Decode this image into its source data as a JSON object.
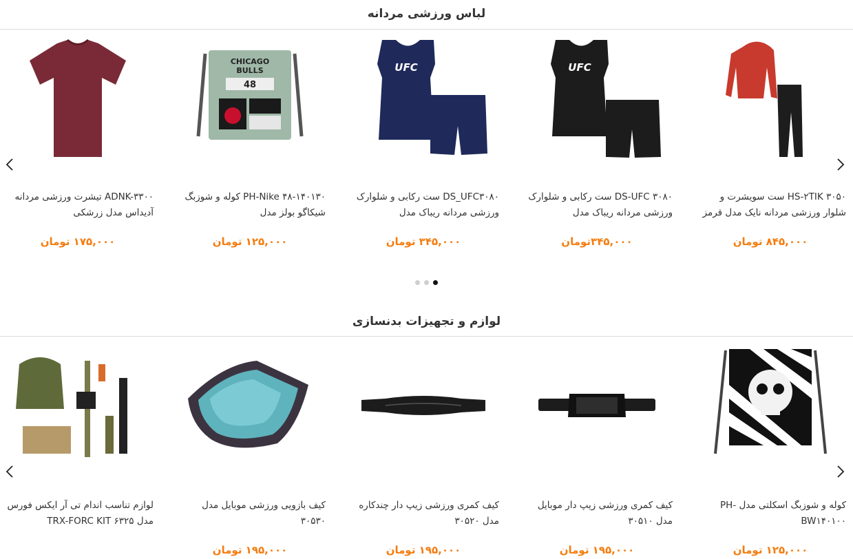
{
  "sections": [
    {
      "title": "لباس ورزشی مردانه",
      "products": [
        {
          "name": "ADNK-۳۳۰۰ تیشرت ورزشی مردانه آدیداس مدل زرشکی",
          "price": "۱۷۵,۰۰۰ تومان"
        },
        {
          "name": "PH-Nike ۴۸-۱۴۰۱۳۰ کوله و شوزبگ شیکاگو بولز مدل",
          "price": "۱۲۵,۰۰۰ تومان"
        },
        {
          "name": "DS_UFC۳۰۸۰ ست رکابی و شلوارک ورزشی مردانه ریباک مدل",
          "price": "۳۴۵,۰۰۰ تومان"
        },
        {
          "name": "DS-UFC ۳۰۸۰ ست رکابی و شلوارک ورزشی مردانه ریباک مدل",
          "price": "۳۴۵,۰۰۰تومان"
        },
        {
          "name": "HS-۲TIK ۳۰۵۰ ست سویشرت و شلوار ورزشی مردانه نایک مدل قرمز",
          "price": "۸۴۵,۰۰۰ تومان"
        }
      ]
    },
    {
      "title": "لوازم و تجهیزات بدنسازی",
      "products": [
        {
          "name": "لوازم تناسب اندام تی آر ایکس فورس مدل TRX-FORC KIT ۶۳۲۵",
          "price": ""
        },
        {
          "name": "کیف بازویی ورزشی موبایل مدل ۳۰۵۳۰",
          "price": "۱۹۵,۰۰۰ تومان"
        },
        {
          "name": "کیف کمری ورزشی زیپ دار چندکاره مدل ۳۰۵۲۰",
          "price": "۱۹۵,۰۰۰ تومان"
        },
        {
          "name": "کیف کمری ورزشی زیپ دار موبایل مدل ۳۰۵۱۰",
          "price": "۱۹۵,۰۰۰ تومان"
        },
        {
          "name": "کوله و شوزبگ اسکلتی مدل -PH BW۱۴۰۱۰۰",
          "price": "۱۲۵,۰۰۰ تومان"
        }
      ]
    }
  ],
  "carousel_dots": {
    "count": 3,
    "active_index": 2
  },
  "icons": [
    "chevron-left-icon",
    "chevron-right-icon"
  ],
  "colors": {
    "price": "#f57c0f",
    "divider": "#dcdcdc",
    "dot_active": "#111111",
    "dot_inactive": "#cfcfcf"
  },
  "image_texts": {
    "ufc": "UFC",
    "chicago_line1": "CHICAGO",
    "chicago_line2": "BULLS",
    "chicago_number": "48"
  }
}
